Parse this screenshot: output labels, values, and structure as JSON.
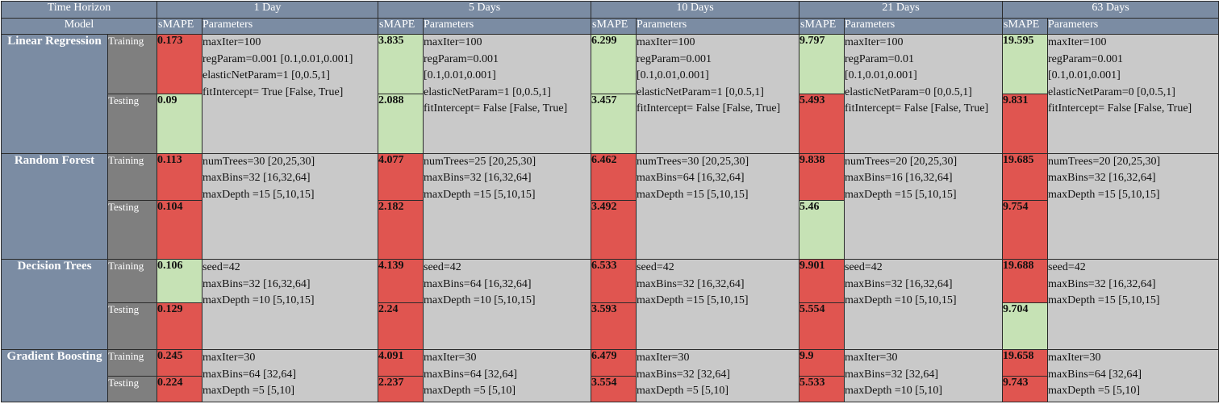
{
  "header": {
    "time_horizon": "Time Horizon",
    "model": "Model",
    "horizons": [
      "1 Day",
      "5 Days",
      "10 Days",
      "21 Days",
      "63 Days"
    ],
    "smape_label": "sMAPE",
    "params_label": "Parameters"
  },
  "labels": {
    "training": "Training",
    "testing": "Testing"
  },
  "colors": {
    "header_bg": "#7b8ca3",
    "split_bg": "#7f7f7f",
    "bad": "#e05550",
    "good": "#c6e2b5",
    "params_bg": "#c9c9c9"
  },
  "models": [
    {
      "name": "Linear Regression",
      "cells": [
        {
          "train": "0.173",
          "test": "0.09",
          "train_status": "bad",
          "test_status": "good",
          "params": [
            "maxIter=100",
            "regParam=0.001 [0.1,0.01,0.001]",
            "elasticNetParam=1 [0,0.5,1]",
            "fitIntercept= True [False, True]"
          ]
        },
        {
          "train": "3.835",
          "test": "2.088",
          "train_status": "good",
          "test_status": "good",
          "params": [
            "maxIter=100",
            "regParam=0.001",
            "[0.1,0.01,0.001]",
            "elasticNetParam=1 [0,0.5,1]",
            "fitIntercept= False [False, True]"
          ]
        },
        {
          "train": "6.299",
          "test": "3.457",
          "train_status": "good",
          "test_status": "good",
          "params": [
            "maxIter=100",
            "regParam=0.001",
            "[0.1,0.01,0.001]",
            "elasticNetParam=1 [0,0.5,1]",
            "fitIntercept= False [False, True]"
          ]
        },
        {
          "train": "9.797",
          "test": "5.493",
          "train_status": "good",
          "test_status": "bad",
          "params": [
            "maxIter=100",
            "regParam=0.01",
            "[0.1,0.01,0.001]",
            "elasticNetParam=0 [0,0.5,1]",
            "fitIntercept= False [False, True]"
          ]
        },
        {
          "train": "19.595",
          "test": "9.831",
          "train_status": "good",
          "test_status": "bad",
          "params": [
            "maxIter=100",
            "regParam=0.001",
            "[0.1,0.01,0.001]",
            "elasticNetParam=0 [0,0.5,1]",
            "fitIntercept= False [False, True]"
          ]
        }
      ]
    },
    {
      "name": "Random Forest",
      "cells": [
        {
          "train": "0.113",
          "test": "0.104",
          "train_status": "bad",
          "test_status": "bad",
          "params": [
            "numTrees=30 [20,25,30]",
            "maxBins=32 [16,32,64]",
            "maxDepth =15 [5,10,15]"
          ]
        },
        {
          "train": "4.077",
          "test": "2.182",
          "train_status": "bad",
          "test_status": "bad",
          "params": [
            "numTrees=25 [20,25,30]",
            "maxBins=32 [16,32,64]",
            "maxDepth =15 [5,10,15]"
          ]
        },
        {
          "train": "6.462",
          "test": "3.492",
          "train_status": "bad",
          "test_status": "bad",
          "params": [
            "numTrees=30 [20,25,30]",
            "maxBins=64 [16,32,64]",
            "maxDepth =15 [5,10,15]"
          ]
        },
        {
          "train": "9.838",
          "test": "5.46",
          "train_status": "bad",
          "test_status": "good",
          "params": [
            "numTrees=20 [20,25,30]",
            "maxBins=16 [16,32,64]",
            "maxDepth =15 [5,10,15]"
          ]
        },
        {
          "train": "19.685",
          "test": "9.754",
          "train_status": "bad",
          "test_status": "bad",
          "params": [
            "numTrees=20 [20,25,30]",
            "maxBins=32 [16,32,64]",
            "maxDepth =15 [5,10,15]"
          ]
        }
      ]
    },
    {
      "name": "Decision Trees",
      "cells": [
        {
          "train": "0.106",
          "test": "0.129",
          "train_status": "good",
          "test_status": "bad",
          "params": [
            "seed=42",
            "maxBins=32 [16,32,64]",
            "maxDepth =10 [5,10,15]"
          ]
        },
        {
          "train": "4.139",
          "test": "2.24",
          "train_status": "bad",
          "test_status": "bad",
          "params": [
            "seed=42",
            "maxBins=64 [16,32,64]",
            "maxDepth =10 [5,10,15]"
          ]
        },
        {
          "train": "6.533",
          "test": "3.593",
          "train_status": "bad",
          "test_status": "bad",
          "params": [
            "seed=42",
            "maxBins=32 [16,32,64]",
            "maxDepth =15 [5,10,15]"
          ]
        },
        {
          "train": "9.901",
          "test": "5.554",
          "train_status": "bad",
          "test_status": "bad",
          "params": [
            "seed=42",
            "maxBins=32 [16,32,64]",
            "maxDepth =10 [5,10,15]"
          ]
        },
        {
          "train": "19.688",
          "test": "9.704",
          "train_status": "bad",
          "test_status": "good",
          "params": [
            "seed=42",
            "maxBins=32 [16,32,64]",
            "maxDepth =15 [5,10,15]"
          ]
        }
      ]
    },
    {
      "name": "Gradient Boosting",
      "cells": [
        {
          "train": "0.245",
          "test": "0.224",
          "train_status": "bad",
          "test_status": "bad",
          "params": [
            "maxIter=30",
            "maxBins=64 [32,64]",
            "maxDepth =5 [5,10]"
          ]
        },
        {
          "train": "4.091",
          "test": "2.237",
          "train_status": "bad",
          "test_status": "bad",
          "params": [
            "maxIter=30",
            "maxBins=64 [32,64]",
            "maxDepth =5 [5,10]"
          ]
        },
        {
          "train": "6.479",
          "test": "3.554",
          "train_status": "bad",
          "test_status": "bad",
          "params": [
            "maxIter=30",
            "maxBins=32 [32,64]",
            "maxDepth =5 [5,10]"
          ]
        },
        {
          "train": "9.9",
          "test": "5.533",
          "train_status": "bad",
          "test_status": "bad",
          "params": [
            "maxIter=30",
            "maxBins=32 [32,64]",
            "maxDepth =10 [5,10]"
          ]
        },
        {
          "train": "19.658",
          "test": "9.743",
          "train_status": "bad",
          "test_status": "bad",
          "params": [
            "maxIter=30",
            "maxBins=64 [32,64]",
            "maxDepth =5 [5,10]"
          ]
        }
      ]
    }
  ]
}
